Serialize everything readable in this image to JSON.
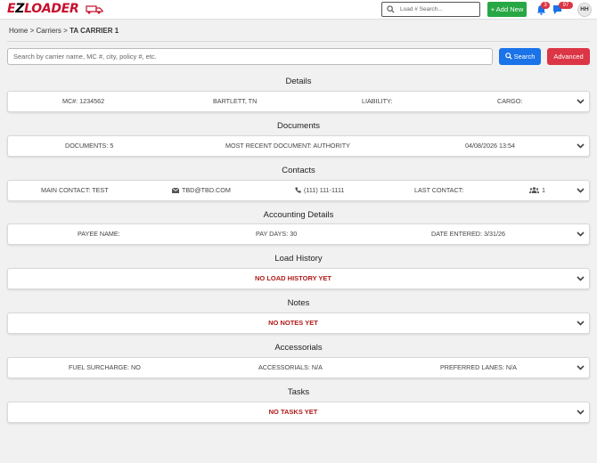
{
  "header": {
    "logo_text_prefix": "E",
    "logo_text_z": "Z",
    "logo_text_suffix": "LOADER",
    "load_search_placeholder": "Load # Search...",
    "add_new_label": "+ Add New",
    "bell_count": "3",
    "chat_count": "97",
    "avatar_initials": "HH"
  },
  "breadcrumb": {
    "home": "Home",
    "sep1": ">",
    "carriers": "Carriers",
    "sep2": ">",
    "current": "TA CARRIER 1"
  },
  "search": {
    "placeholder": "Search by carrier name, MC #, city, policy #, etc.",
    "search_label": "Search",
    "advanced_label": "Advanced"
  },
  "sections": {
    "details": {
      "title": "Details",
      "mc": "MC#: 1234562",
      "location": "BARTLETT, TN",
      "liability": "LIABILITY:",
      "cargo": "CARGO:"
    },
    "documents": {
      "title": "Documents",
      "count": "DOCUMENTS: 5",
      "recent": "MOST RECENT DOCUMENT: AUTHORITY",
      "date": "04/08/2026 13:54"
    },
    "contacts": {
      "title": "Contacts",
      "main_contact": "MAIN CONTACT: TEST",
      "email": "TBD@TBD.COM",
      "phone": "(111) 111-1111",
      "last_contact": "LAST CONTACT:",
      "people_count": "1"
    },
    "accounting": {
      "title": "Accounting Details",
      "payee": "PAYEE NAME:",
      "pay_days": "PAY DAYS: 30",
      "date_entered": "DATE ENTERED: 3/31/26"
    },
    "load_history": {
      "title": "Load History",
      "empty": "NO LOAD HISTORY YET"
    },
    "notes": {
      "title": "Notes",
      "empty": "NO NOTES YET"
    },
    "accessorials": {
      "title": "Accessorials",
      "fuel": "FUEL SURCHARGE: NO",
      "accessorials": "ACCESSORIALS: N/A",
      "lanes": "PREFERRED LANES: N/A"
    },
    "tasks": {
      "title": "Tasks",
      "empty": "NO TASKS YET"
    }
  },
  "colors": {
    "brand_red": "#c8102e",
    "add_green": "#28a745",
    "search_blue": "#1a73e8",
    "advanced_red": "#dc3545",
    "empty_text_red": "#b01a1a"
  }
}
